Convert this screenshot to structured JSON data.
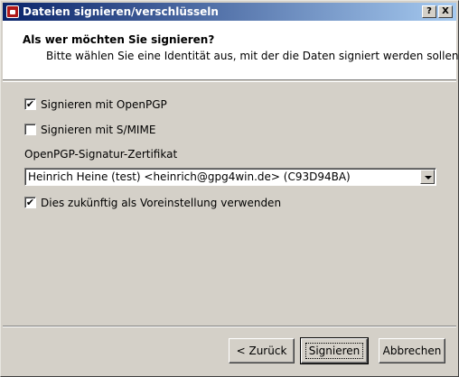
{
  "window": {
    "title": "Dateien signieren/verschlüsseln",
    "help_label": "?",
    "close_label": "X"
  },
  "header": {
    "title": "Als wer möchten Sie signieren?",
    "subtitle": "Bitte wählen Sie eine Identität aus, mit der die Daten signiert werden sollen."
  },
  "options": {
    "openpgp": {
      "label": "Signieren mit OpenPGP",
      "checked": true
    },
    "smime": {
      "label": "Signieren mit S/MIME",
      "checked": false
    }
  },
  "certificate": {
    "label": "OpenPGP-Signatur-Zertifikat",
    "selected": "Heinrich Heine (test) <heinrich@gpg4win.de> (C93D94BA)"
  },
  "default_option": {
    "label": "Dies zukünftig als Voreinstellung verwenden",
    "checked": true
  },
  "buttons": {
    "back": "< Zurück",
    "sign": "Signieren",
    "cancel": "Abbrechen"
  },
  "check_mark": "✔"
}
